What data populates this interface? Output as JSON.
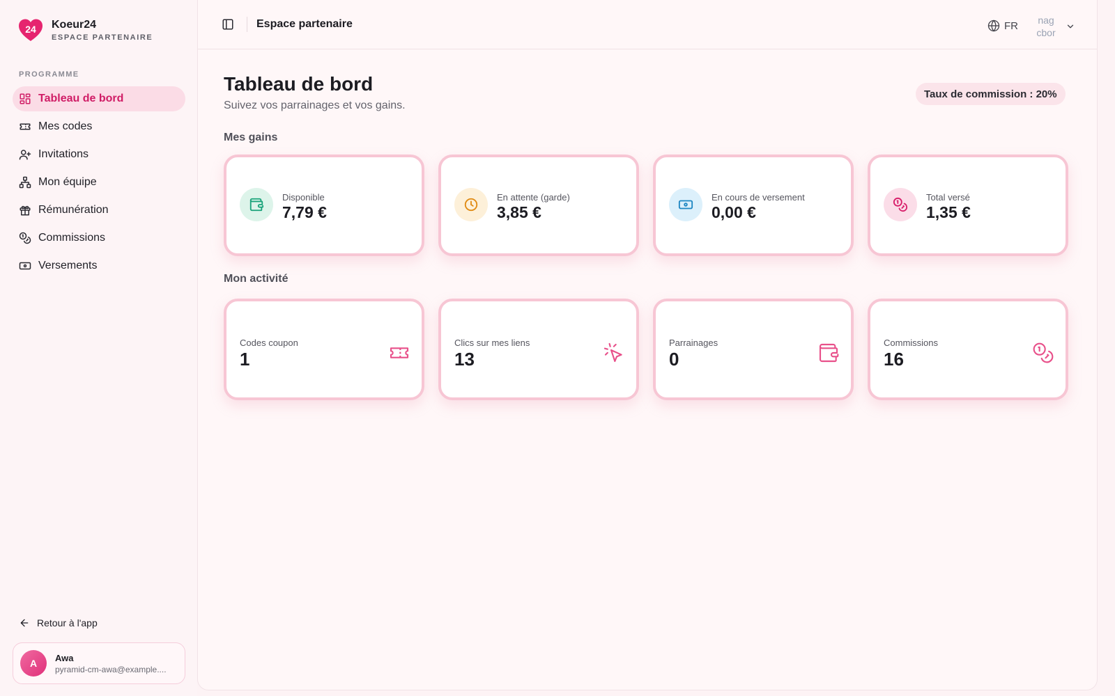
{
  "brand": {
    "name": "Koeur24",
    "subtitle": "ESPACE PARTENAIRE",
    "logo_text": "24"
  },
  "sidebar": {
    "section_label": "PROGRAMME",
    "items": [
      {
        "label": "Tableau de bord",
        "icon": "dashboard-icon",
        "active": true
      },
      {
        "label": "Mes codes",
        "icon": "ticket-icon"
      },
      {
        "label": "Invitations",
        "icon": "user-plus-icon"
      },
      {
        "label": "Mon équipe",
        "icon": "network-icon"
      },
      {
        "label": "Rémunération",
        "icon": "gift-icon"
      },
      {
        "label": "Commissions",
        "icon": "coins-icon"
      },
      {
        "label": "Versements",
        "icon": "banknote-icon"
      }
    ],
    "back_label": "Retour à l'app",
    "user": {
      "initial": "A",
      "name": "Awa",
      "email": "pyramid-cm-awa@example...."
    }
  },
  "topbar": {
    "title": "Espace partenaire",
    "language": "FR",
    "avatar_text": "nag\ncbor"
  },
  "page": {
    "title": "Tableau de bord",
    "subtitle": "Suivez vos parrainages et vos gains.",
    "commission_badge": "Taux de commission : 20%"
  },
  "gains": {
    "title": "Mes gains",
    "cards": [
      {
        "label": "Disponible",
        "value": "7,79 €",
        "icon": "wallet-icon",
        "color": "#1aa37a",
        "bg": "#ddf4ea"
      },
      {
        "label": "En attente (garde)",
        "value": "3,85 €",
        "icon": "clock-icon",
        "color": "#e08a12",
        "bg": "#fdf0d9"
      },
      {
        "label": "En cours de versement",
        "value": "0,00 €",
        "icon": "banknote-icon",
        "color": "#1d86c2",
        "bg": "#dcf0fb"
      },
      {
        "label": "Total versé",
        "value": "1,35 €",
        "icon": "coins-icon",
        "color": "#d81e6a",
        "bg": "#fbdde8"
      }
    ]
  },
  "activity": {
    "title": "Mon activité",
    "cards": [
      {
        "label": "Codes coupon",
        "value": "1",
        "icon": "ticket-icon"
      },
      {
        "label": "Clics sur mes liens",
        "value": "13",
        "icon": "cursor-click-icon"
      },
      {
        "label": "Parrainages",
        "value": "0",
        "icon": "wallet-icon"
      },
      {
        "label": "Commissions",
        "value": "16",
        "icon": "coins-icon"
      }
    ],
    "icon_color": "#e8508a"
  },
  "colors": {
    "accent": "#d01d66",
    "card_border": "#f7c6d4"
  }
}
